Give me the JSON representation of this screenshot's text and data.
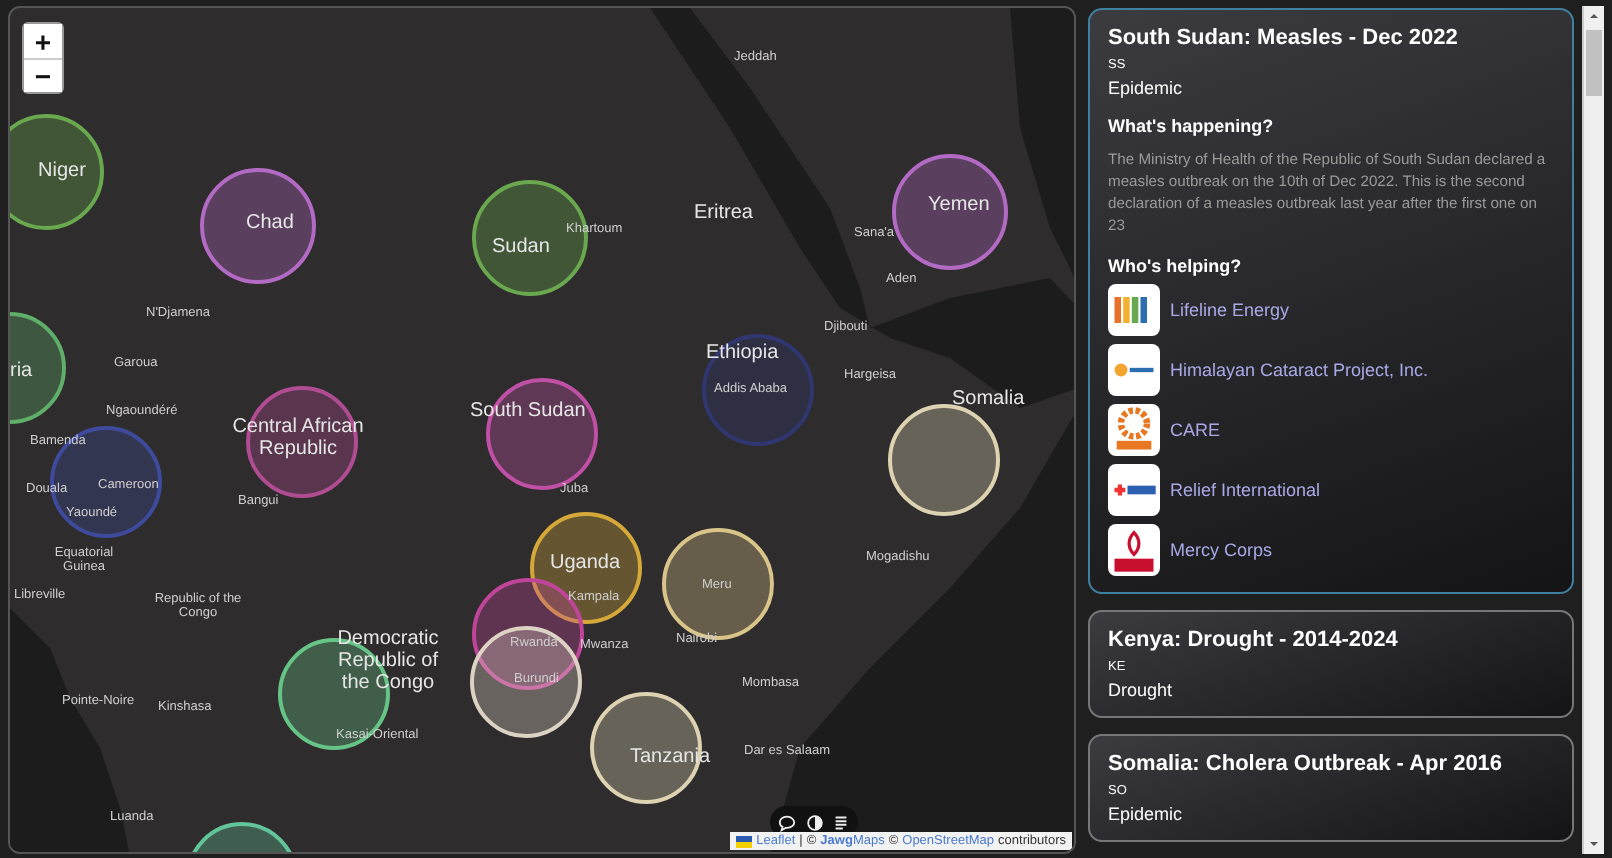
{
  "map": {
    "zoom_in": "+",
    "zoom_out": "−",
    "circles": [
      {
        "color": "#6aa84f"
      },
      {
        "color": "#b36ac4"
      },
      {
        "color": "#6aa84f"
      },
      {
        "color": "#b36ac4"
      },
      {
        "color": "#5fae6a"
      },
      {
        "color": "#3e4a9c"
      },
      {
        "color": "#b04c92"
      },
      {
        "color": "#c050a6"
      },
      {
        "color": "#2f3670"
      },
      {
        "color": "#ddd3b2"
      },
      {
        "color": "#d6a83a"
      },
      {
        "color": "#d9c48a"
      },
      {
        "color": "#c0459a"
      },
      {
        "color": "#ddd3c4"
      },
      {
        "color": "#66c487"
      },
      {
        "color": "#ddd3b2"
      },
      {
        "color": "#62c49a"
      }
    ],
    "labels": [
      {
        "text": "Niger",
        "kind": "country"
      },
      {
        "text": "Chad",
        "kind": "country"
      },
      {
        "text": "Sudan",
        "kind": "country"
      },
      {
        "text": "Yemen",
        "kind": "country"
      },
      {
        "text": "ria",
        "kind": "country"
      },
      {
        "text": "Eritrea",
        "kind": "country"
      },
      {
        "text": "Ethiopia",
        "kind": "country"
      },
      {
        "text": "Somalia",
        "kind": "country"
      },
      {
        "text": "South Sudan",
        "kind": "country"
      },
      {
        "text": "Central African Republic",
        "kind": "country"
      },
      {
        "text": "Uganda",
        "kind": "country"
      },
      {
        "text": "Democratic Republic of the Congo",
        "kind": "country"
      },
      {
        "text": "Tanzania",
        "kind": "country"
      },
      {
        "text": "Jeddah",
        "kind": "city"
      },
      {
        "text": "Khartoum",
        "kind": "city"
      },
      {
        "text": "Sana'a",
        "kind": "city"
      },
      {
        "text": "Aden",
        "kind": "city"
      },
      {
        "text": "Djibouti",
        "kind": "city"
      },
      {
        "text": "N'Djamena",
        "kind": "city"
      },
      {
        "text": "Garoua",
        "kind": "city"
      },
      {
        "text": "Ngaoundéré",
        "kind": "city"
      },
      {
        "text": "Hargeisa",
        "kind": "city"
      },
      {
        "text": "Addis Ababa",
        "kind": "city"
      },
      {
        "text": "Bamenda",
        "kind": "city"
      },
      {
        "text": "Douala",
        "kind": "city"
      },
      {
        "text": "Cameroon",
        "kind": "city"
      },
      {
        "text": "Yaoundé",
        "kind": "city"
      },
      {
        "text": "Bangui",
        "kind": "city"
      },
      {
        "text": "Juba",
        "kind": "city"
      },
      {
        "text": "Equatorial Guinea",
        "kind": "city"
      },
      {
        "text": "Libreville",
        "kind": "city"
      },
      {
        "text": "Republic of the Congo",
        "kind": "city"
      },
      {
        "text": "Kampala",
        "kind": "city"
      },
      {
        "text": "Mogadishu",
        "kind": "city"
      },
      {
        "text": "Meru",
        "kind": "city"
      },
      {
        "text": "Rwanda",
        "kind": "city"
      },
      {
        "text": "Nairobi",
        "kind": "city"
      },
      {
        "text": "Mwanza",
        "kind": "city"
      },
      {
        "text": "Burundi",
        "kind": "city"
      },
      {
        "text": "Pointe-Noire",
        "kind": "city"
      },
      {
        "text": "Kinshasa",
        "kind": "city"
      },
      {
        "text": "Kasai-Oriental",
        "kind": "city"
      },
      {
        "text": "Mombasa",
        "kind": "city"
      },
      {
        "text": "Dar es Salaam",
        "kind": "city"
      },
      {
        "text": "Luanda",
        "kind": "city"
      }
    ],
    "attribution": {
      "leaflet": "Leaflet",
      "sep": "|",
      "copy1": "©",
      "jawg": "**Jawg**Maps",
      "copy2": "©",
      "osm": "OpenStreetMap",
      "tail": "contributors"
    }
  },
  "events": [
    {
      "title": "South Sudan: Measles - Dec 2022",
      "code": "SS",
      "type": "Epidemic",
      "selected": true,
      "happening_heading": "What's happening?",
      "description": "The Ministry of Health of the Republic of South Sudan declared a measles outbreak on the 10th of Dec 2022. This is the second declaration of a measles outbreak last year after the first one on 23",
      "helping_heading": "Who's helping?",
      "orgs": [
        {
          "name": "Lifeline Energy",
          "kind": "lifeline"
        },
        {
          "name": "Himalayan Cataract Project, Inc.",
          "kind": "cataract"
        },
        {
          "name": "CARE",
          "kind": "care"
        },
        {
          "name": "Relief International",
          "kind": "relief"
        },
        {
          "name": "Mercy Corps",
          "kind": "mercy"
        }
      ]
    },
    {
      "title": "Kenya: Drought - 2014-2024",
      "code": "KE",
      "type": "Drought",
      "selected": false
    },
    {
      "title": "Somalia: Cholera Outbreak - Apr 2016",
      "code": "SO",
      "type": "Epidemic",
      "selected": false
    }
  ]
}
